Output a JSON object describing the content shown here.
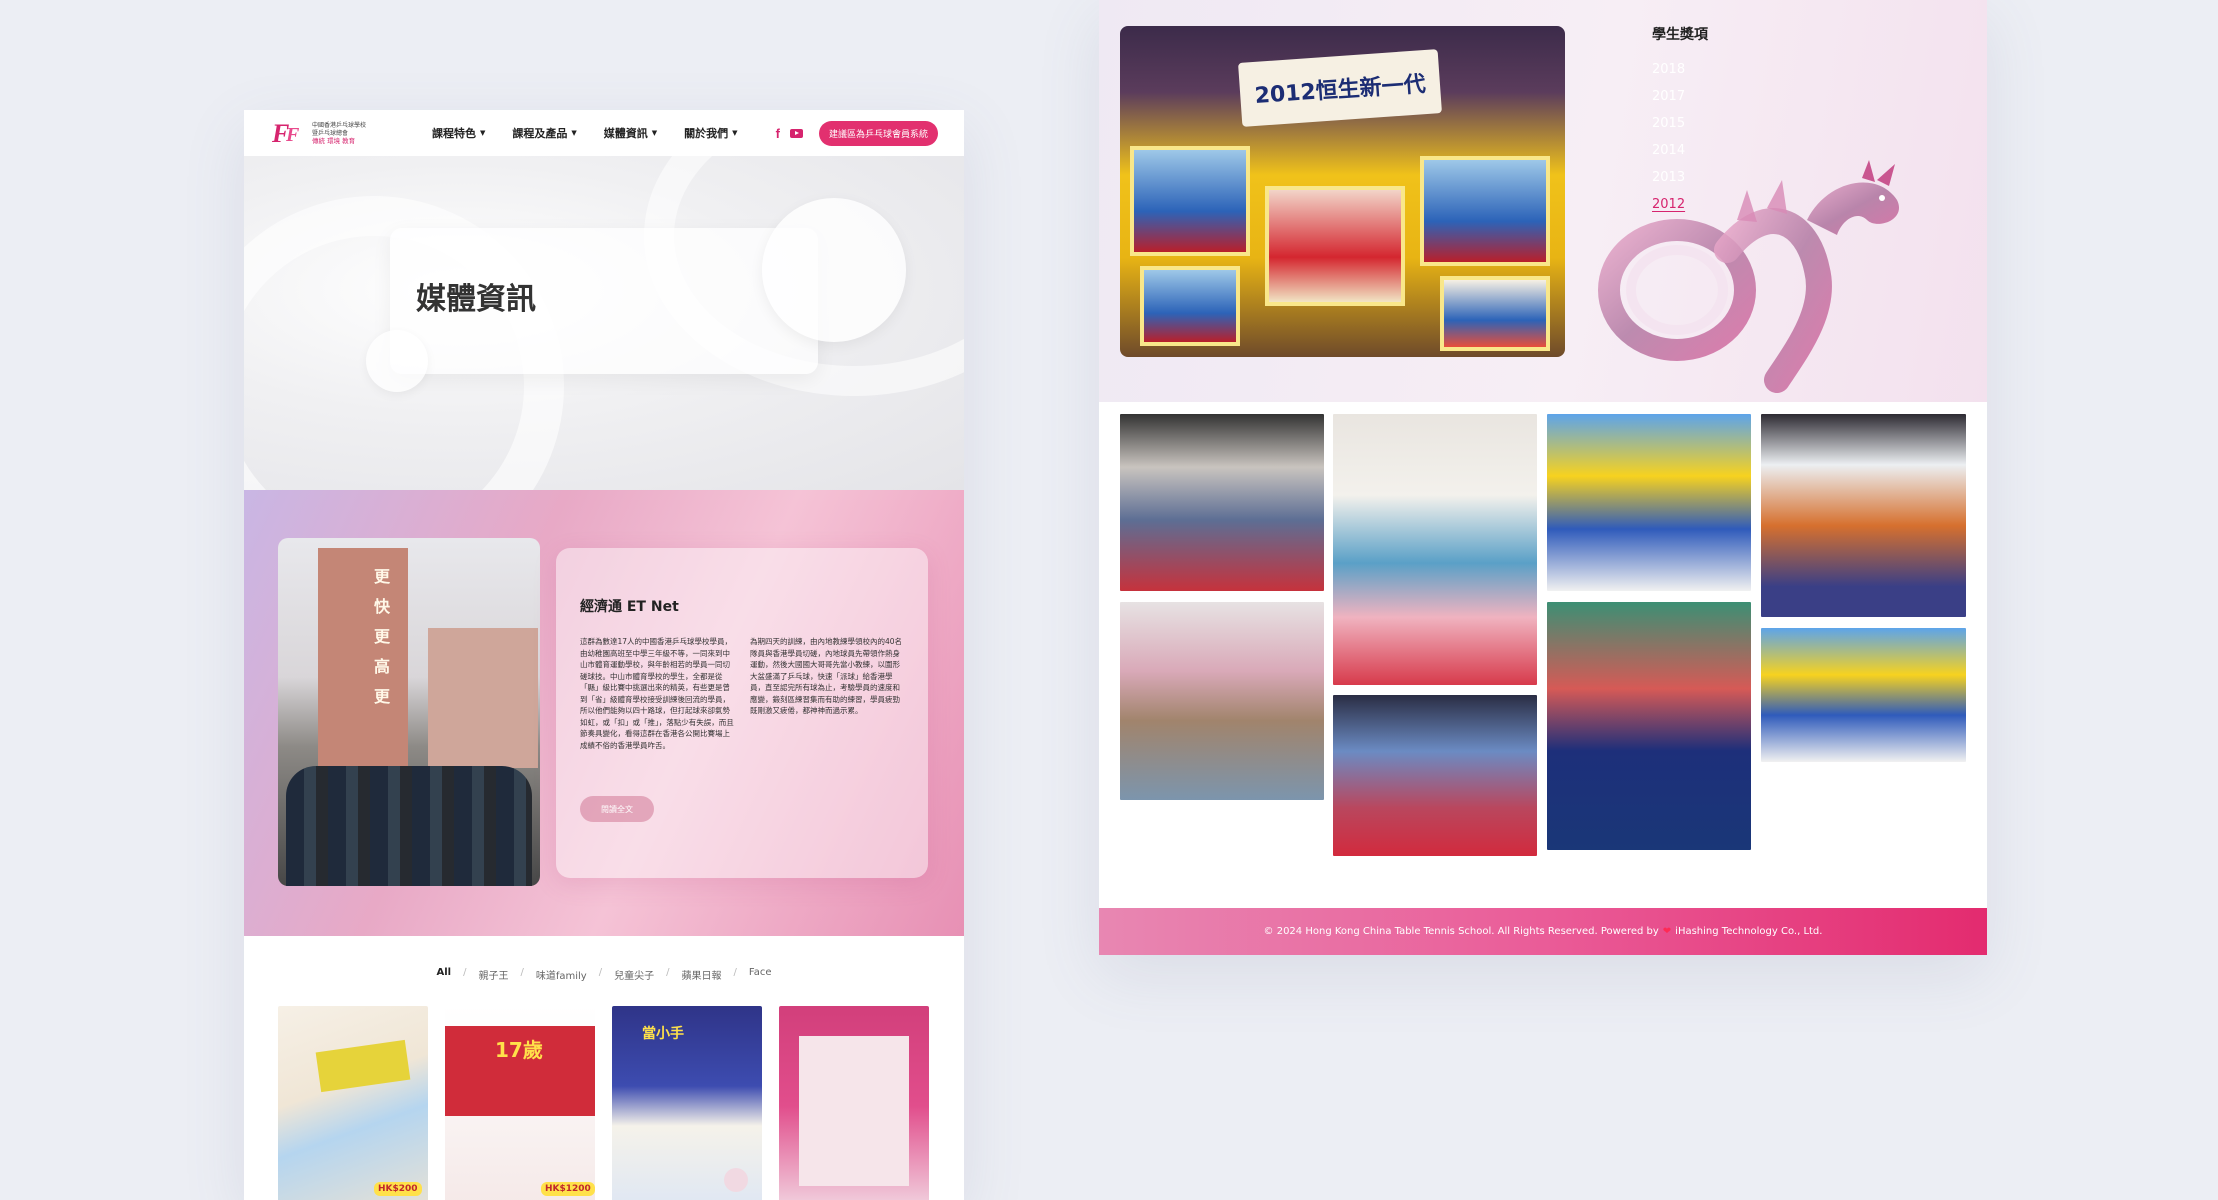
{
  "left_page": {
    "nav": {
      "logo_lines": [
        "中國香港乒乓球學校",
        "暨乒乓球總會"
      ],
      "logo_tagline": "傳統 環境 教育",
      "menu": [
        {
          "label": "課程特色"
        },
        {
          "label": "課程及產品"
        },
        {
          "label": "媒體資訊"
        },
        {
          "label": "關於我們"
        }
      ],
      "social": [
        "facebook-icon",
        "youtube-icon"
      ],
      "cta_label": "建議區為乒乓球會員系統"
    },
    "hero": {
      "title": "媒體資訊"
    },
    "feature": {
      "heading": "經濟通 ET Net",
      "body_left": "這群為數達17人的中國香港乒乓球學校學員，由幼稚園高班至中學三年級不等，一同來到中山市體育運動學校，與年齡相若的學員一同切磋球技。中山市體育學校的學生，全都是從「縣」級比賽中挑選出來的精英，有些更是曾到「省」級體育學校接受訓練後回流的學員，所以他們能夠以四十路球，但打起球來卻氣勢如虹，或「扣」或「推」，落點少有失誤，而且節奏具變化，看得這群在香港各公開比賽場上成績不俗的香港學員咋舌。",
      "body_right": "為期四天的訓練，由內地教練學領校內的40名隊員與香港學員切磋，內地球員先帶領作熱身運動，然後大國國大哥哥先當小教練，以圍形大盆盛滿了乒乓球，快速「派球」給香港學員，直至認完所有球為止，考驗學員的速度和應變，鍛刻區練習集而有助的練習，學員疲勁既剛激又疲倦，都神神而過示累。",
      "read_more_label": "閱讀全文"
    },
    "filters": {
      "items": [
        "All",
        "親子王",
        "味道family",
        "兒童尖子",
        "蘋果日報",
        "Face"
      ],
      "active": "All"
    },
    "thumbs": [
      {
        "headline": "",
        "price": "HK$200"
      },
      {
        "headline": "17歲",
        "price": "HK$1200"
      },
      {
        "headline": "當小手",
        "price": ""
      },
      {
        "headline": "",
        "price": ""
      }
    ]
  },
  "right_page": {
    "main_photo_banner": "2012恒生新一代",
    "awards": {
      "title": "學生獎項",
      "years": [
        "2018",
        "2017",
        "2015",
        "2014",
        "2013",
        "2012"
      ],
      "active_year": "2012"
    },
    "footer": {
      "copyright": "© 2024 Hong Kong China Table Tennis School. All Rights Reserved. Powered by",
      "powered_by": "iHashing Technology Co., Ltd."
    }
  },
  "colors": {
    "accent": "#e2306f",
    "active_year": "#d6246e",
    "background": "#eceef4"
  }
}
